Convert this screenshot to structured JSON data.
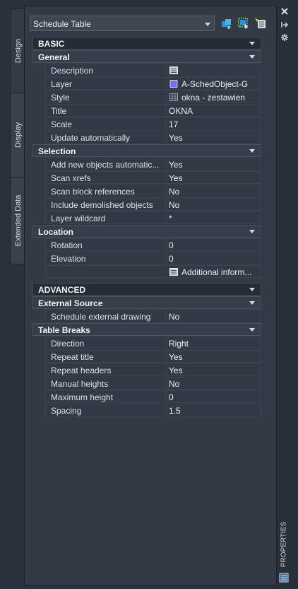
{
  "window": {
    "title": "PROPERTIES"
  },
  "tabs": [
    {
      "label": "Design",
      "active": true
    },
    {
      "label": "Display",
      "active": false
    },
    {
      "label": "Extended Data",
      "active": false
    }
  ],
  "object_select": {
    "value": "Schedule Table"
  },
  "toolbar": {
    "buttons": [
      "add-to-selection-icon",
      "quick-select-icon",
      "pick-properties-icon"
    ]
  },
  "side_buttons": [
    "close-icon",
    "autohide-icon",
    "settings-icon"
  ],
  "sections": {
    "basic": {
      "title": "BASIC"
    },
    "general": {
      "title": "General",
      "rows": [
        {
          "name": "Description",
          "value": ""
        },
        {
          "name": "Layer",
          "value": "A-SchedObject-G"
        },
        {
          "name": "Style",
          "value": "okna - zestawien"
        },
        {
          "name": "Title",
          "value": "OKNA"
        },
        {
          "name": "Scale",
          "value": "17"
        },
        {
          "name": "Update automatically",
          "value": "Yes"
        }
      ]
    },
    "selection": {
      "title": "Selection",
      "rows": [
        {
          "name": "Add new objects automatic...",
          "value": "Yes"
        },
        {
          "name": "Scan xrefs",
          "value": "Yes"
        },
        {
          "name": "Scan block references",
          "value": "No"
        },
        {
          "name": "Include demolished objects",
          "value": "No"
        },
        {
          "name": "Layer wildcard",
          "value": "*"
        }
      ]
    },
    "location": {
      "title": "Location",
      "rows": [
        {
          "name": "Rotation",
          "value": "0"
        },
        {
          "name": "Elevation",
          "value": "0"
        },
        {
          "name": "",
          "value": "Additional  inform..."
        }
      ]
    },
    "advanced": {
      "title": "ADVANCED"
    },
    "external_source": {
      "title": "External Source",
      "rows": [
        {
          "name": "Schedule external drawing",
          "value": "No"
        }
      ]
    },
    "table_breaks": {
      "title": "Table Breaks",
      "rows": [
        {
          "name": "Direction",
          "value": "Right"
        },
        {
          "name": "Repeat title",
          "value": "Yes"
        },
        {
          "name": "Repeat headers",
          "value": "Yes"
        },
        {
          "name": "Manual heights",
          "value": "No"
        },
        {
          "name": "Maximum height",
          "value": "0"
        },
        {
          "name": "Spacing",
          "value": "1.5"
        }
      ]
    }
  },
  "colors": {
    "layer_swatch": "#7b6cf0",
    "background": "#2b313c",
    "panel": "#333a46"
  }
}
